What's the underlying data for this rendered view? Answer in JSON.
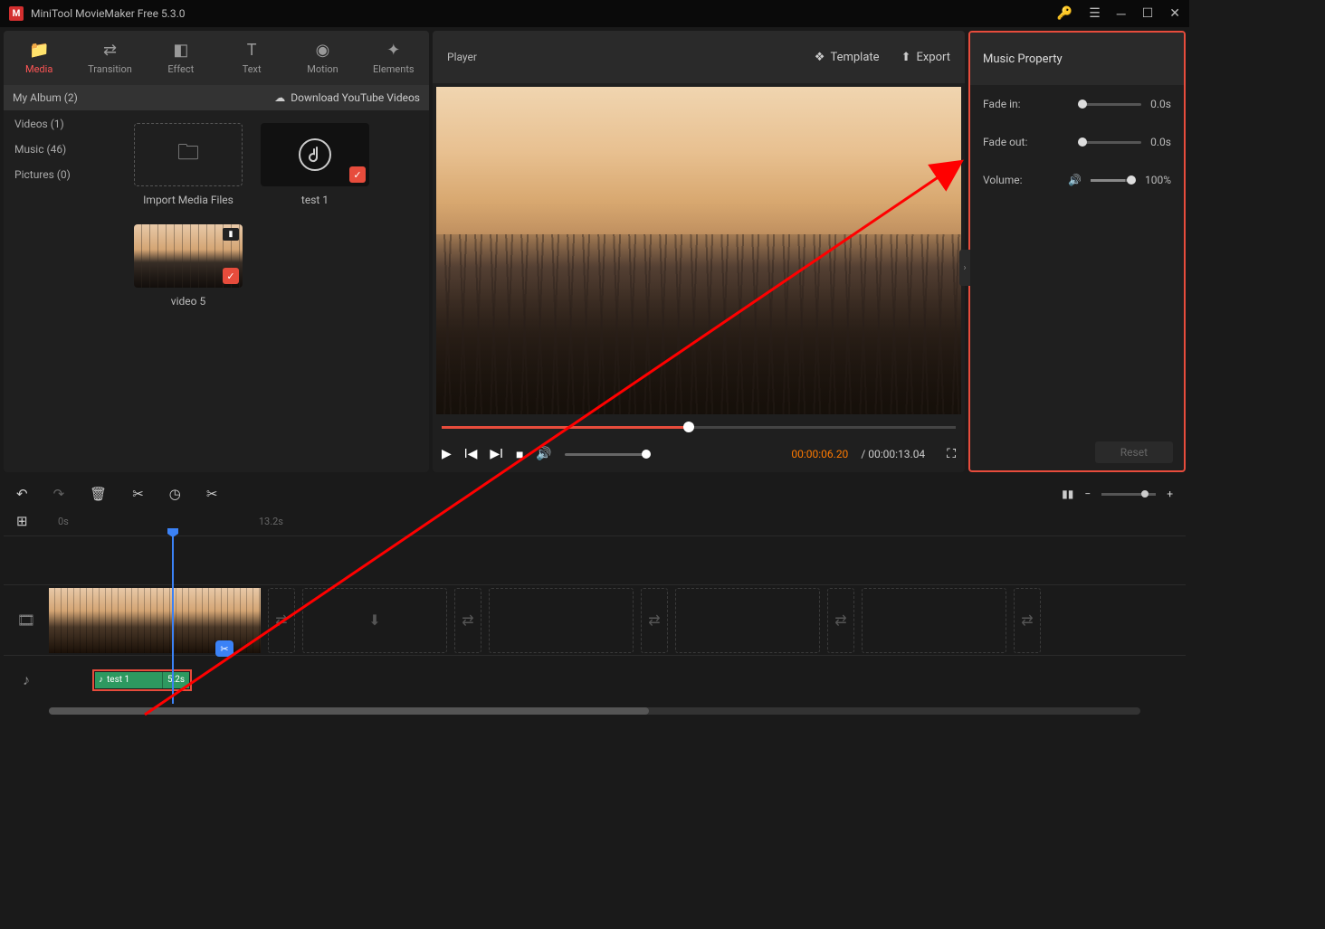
{
  "app": {
    "title": "MiniTool MovieMaker Free 5.3.0"
  },
  "tabs": {
    "media": "Media",
    "transition": "Transition",
    "effect": "Effect",
    "text": "Text",
    "motion": "Motion",
    "elements": "Elements"
  },
  "album": {
    "title": "My Album (2)",
    "download": "Download YouTube Videos"
  },
  "mediaSidebar": {
    "videos": "Videos (1)",
    "music": "Music (46)",
    "pictures": "Pictures (0)"
  },
  "mediaItems": {
    "import": "Import Media Files",
    "test1": "test 1",
    "video5": "video 5"
  },
  "player": {
    "title": "Player",
    "template": "Template",
    "export": "Export",
    "current": "00:00:06.20",
    "sep": "/ ",
    "duration": "00:00:13.04"
  },
  "musicProp": {
    "title": "Music Property",
    "fadein_l": "Fade in:",
    "fadein_v": "0.0s",
    "fadeout_l": "Fade out:",
    "fadeout_v": "0.0s",
    "volume_l": "Volume:",
    "volume_v": "100%",
    "reset": "Reset"
  },
  "ruler": {
    "t0": "0s",
    "t1": "13.2s"
  },
  "audioClip": {
    "name": "test 1",
    "dur": "5.2s"
  }
}
